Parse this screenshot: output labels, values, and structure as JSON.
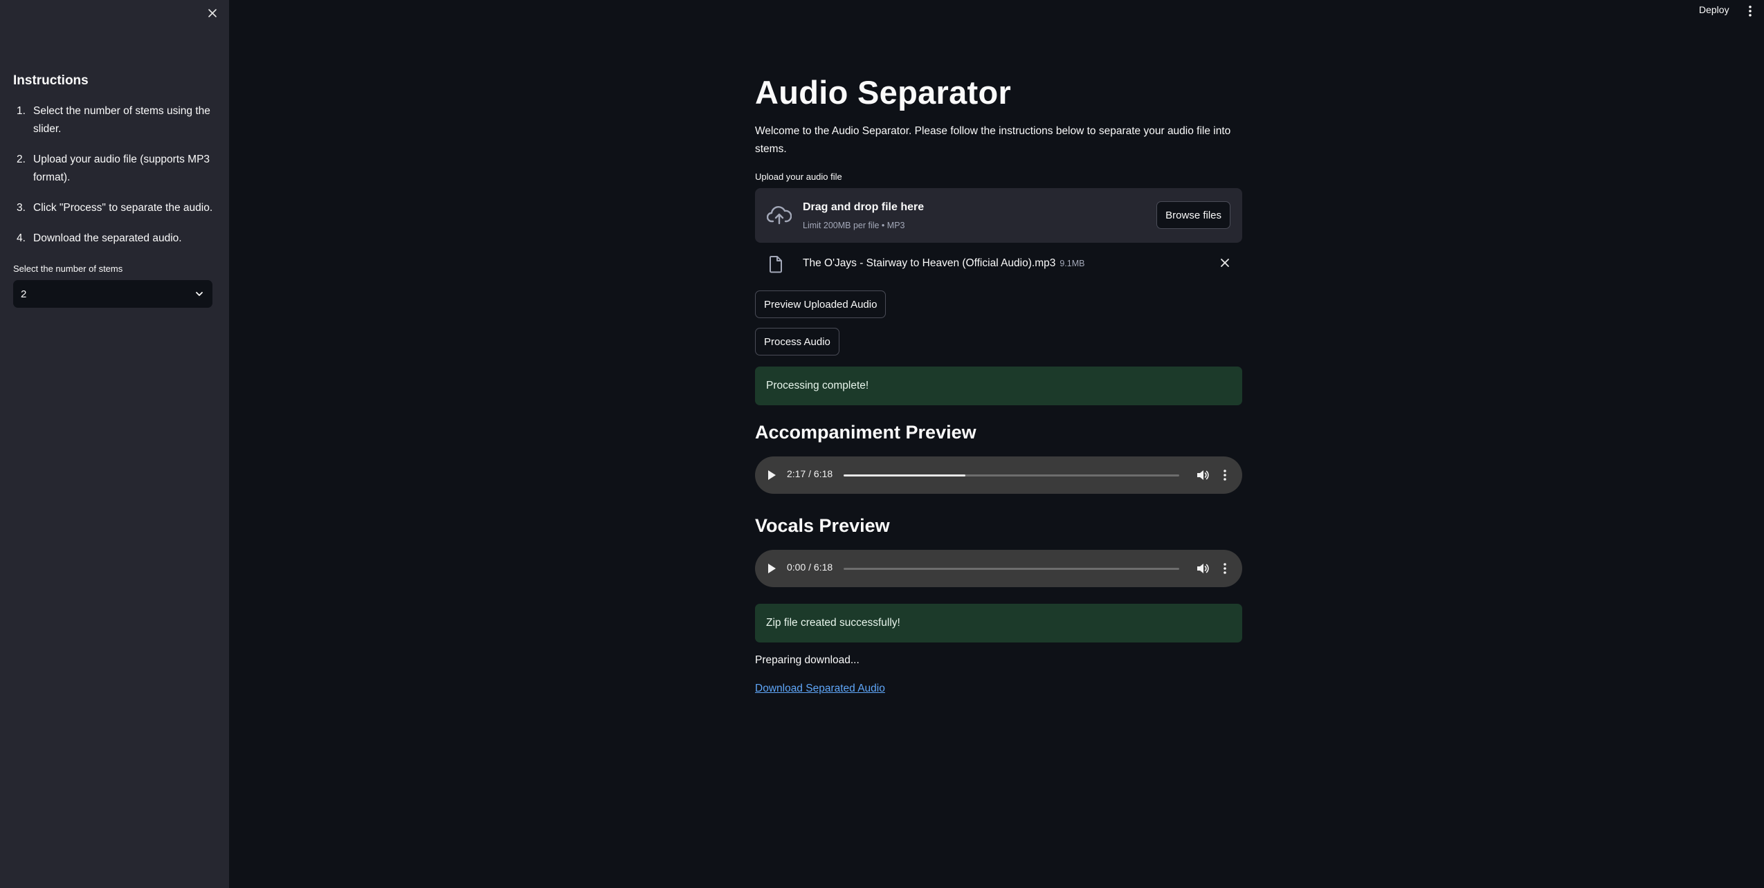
{
  "sidebar": {
    "heading": "Instructions",
    "items": [
      {
        "num": "1.",
        "text": "Select the number of stems using the slider."
      },
      {
        "num": "2.",
        "text": "Upload your audio file (supports MP3 format)."
      },
      {
        "num": "3.",
        "text": "Click \"Process\" to separate the audio."
      },
      {
        "num": "4.",
        "text": "Download the separated audio."
      }
    ],
    "stems_label": "Select the number of stems",
    "stems_value": "2",
    "icons": {
      "close": "close-icon",
      "select": "chevron-down-icon"
    }
  },
  "topbar": {
    "deploy_label": "Deploy",
    "menu_icon": "more-vertical-icon"
  },
  "main": {
    "title": "Audio Separator",
    "welcome": "Welcome to the Audio Separator. Please follow the instructions below to separate your audio file into stems.",
    "upload_label": "Upload your audio file",
    "dropzone": {
      "title": "Drag and drop file here",
      "subtitle": "Limit 200MB per file • MP3",
      "browse_label": "Browse files"
    },
    "file": {
      "name": "The O'Jays - Stairway to Heaven (Official Audio).mp3",
      "size": "9.1MB"
    },
    "preview_button": "Preview Uploaded Audio",
    "process_button": "Process Audio",
    "processing_status": "Processing complete!",
    "accompaniment": {
      "heading": "Accompaniment Preview",
      "time": "2:17 / 6:18",
      "progress": 0.363
    },
    "vocals": {
      "heading": "Vocals Preview",
      "time": "0:00 / 6:18",
      "progress": 0.0
    },
    "zip_status": "Zip file created successfully!",
    "preparing": "Preparing download...",
    "download_link": "Download Separated Audio"
  },
  "colors": {
    "background": "#0e1117",
    "sidebar": "#262730",
    "success_bg": "#1c3a2a",
    "link": "#5fa6f8"
  }
}
